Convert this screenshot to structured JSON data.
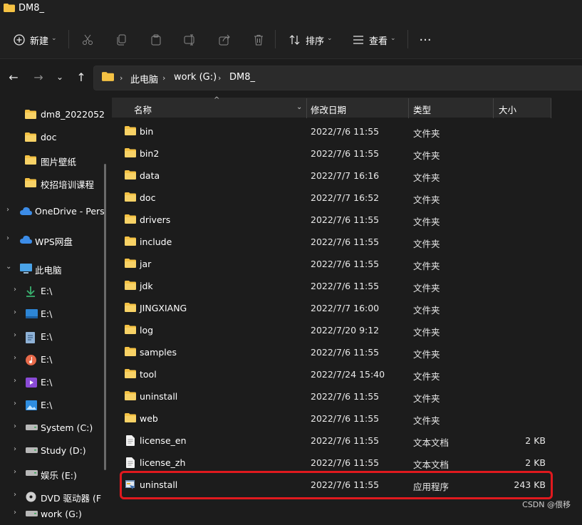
{
  "window": {
    "title": "DM8_"
  },
  "commandbar": {
    "new_label": "新建",
    "sort_label": "排序",
    "view_label": "查看"
  },
  "address": {
    "crumbs": [
      "此电脑",
      "work (G:)",
      "DM8_"
    ]
  },
  "sidebar": {
    "items": [
      {
        "label": "dm8_2022052",
        "icon": "folder-icon"
      },
      {
        "label": "doc",
        "icon": "folder-icon"
      },
      {
        "label": "图片壁纸",
        "icon": "folder-icon"
      },
      {
        "label": "校招培训课程",
        "icon": "folder-icon"
      },
      {
        "label": "OneDrive - Pers",
        "icon": "cloud-icon"
      },
      {
        "label": "WPS网盘",
        "icon": "cloud-icon"
      },
      {
        "label": "此电脑",
        "icon": "computer-icon"
      },
      {
        "label": "E:\\",
        "icon": "download-icon"
      },
      {
        "label": "E:\\",
        "icon": "desktop-icon"
      },
      {
        "label": "E:\\",
        "icon": "document-icon"
      },
      {
        "label": "E:\\",
        "icon": "music-icon"
      },
      {
        "label": "E:\\",
        "icon": "video-icon"
      },
      {
        "label": "E:\\",
        "icon": "picture-icon"
      },
      {
        "label": "System (C:)",
        "icon": "drive-icon"
      },
      {
        "label": "Study (D:)",
        "icon": "drive-icon"
      },
      {
        "label": "娱乐 (E:)",
        "icon": "drive-icon"
      },
      {
        "label": "DVD 驱动器 (F",
        "icon": "disc-icon"
      },
      {
        "label": "work (G:)",
        "icon": "drive-icon"
      }
    ]
  },
  "columns": {
    "name": "名称",
    "date": "修改日期",
    "type": "类型",
    "size": "大小"
  },
  "files": [
    {
      "name": "bin",
      "date": "2022/7/6 11:55",
      "type": "文件夹",
      "size": "",
      "icon": "folder-icon"
    },
    {
      "name": "bin2",
      "date": "2022/7/6 11:55",
      "type": "文件夹",
      "size": "",
      "icon": "folder-icon"
    },
    {
      "name": "data",
      "date": "2022/7/7 16:16",
      "type": "文件夹",
      "size": "",
      "icon": "folder-icon"
    },
    {
      "name": "doc",
      "date": "2022/7/7 16:52",
      "type": "文件夹",
      "size": "",
      "icon": "folder-icon"
    },
    {
      "name": "drivers",
      "date": "2022/7/6 11:55",
      "type": "文件夹",
      "size": "",
      "icon": "folder-icon"
    },
    {
      "name": "include",
      "date": "2022/7/6 11:55",
      "type": "文件夹",
      "size": "",
      "icon": "folder-icon"
    },
    {
      "name": "jar",
      "date": "2022/7/6 11:55",
      "type": "文件夹",
      "size": "",
      "icon": "folder-icon"
    },
    {
      "name": "jdk",
      "date": "2022/7/6 11:55",
      "type": "文件夹",
      "size": "",
      "icon": "folder-icon"
    },
    {
      "name": "JINGXIANG",
      "date": "2022/7/7 16:00",
      "type": "文件夹",
      "size": "",
      "icon": "folder-icon"
    },
    {
      "name": "log",
      "date": "2022/7/20 9:12",
      "type": "文件夹",
      "size": "",
      "icon": "folder-icon"
    },
    {
      "name": "samples",
      "date": "2022/7/6 11:55",
      "type": "文件夹",
      "size": "",
      "icon": "folder-icon"
    },
    {
      "name": "tool",
      "date": "2022/7/24 15:40",
      "type": "文件夹",
      "size": "",
      "icon": "folder-icon"
    },
    {
      "name": "uninstall",
      "date": "2022/7/6 11:55",
      "type": "文件夹",
      "size": "",
      "icon": "folder-icon"
    },
    {
      "name": "web",
      "date": "2022/7/6 11:55",
      "type": "文件夹",
      "size": "",
      "icon": "folder-icon"
    },
    {
      "name": "license_en",
      "date": "2022/7/6 11:55",
      "type": "文本文档",
      "size": "2 KB",
      "icon": "text-file-icon"
    },
    {
      "name": "license_zh",
      "date": "2022/7/6 11:55",
      "type": "文本文档",
      "size": "2 KB",
      "icon": "text-file-icon"
    },
    {
      "name": "uninstall",
      "date": "2022/7/6 11:55",
      "type": "应用程序",
      "size": "243 KB",
      "icon": "application-icon"
    }
  ],
  "watermark": "CSDN @偎移",
  "colors": {
    "folder": "#f5c244",
    "highlight": "#e0191e",
    "background": "#1c1c1c"
  }
}
